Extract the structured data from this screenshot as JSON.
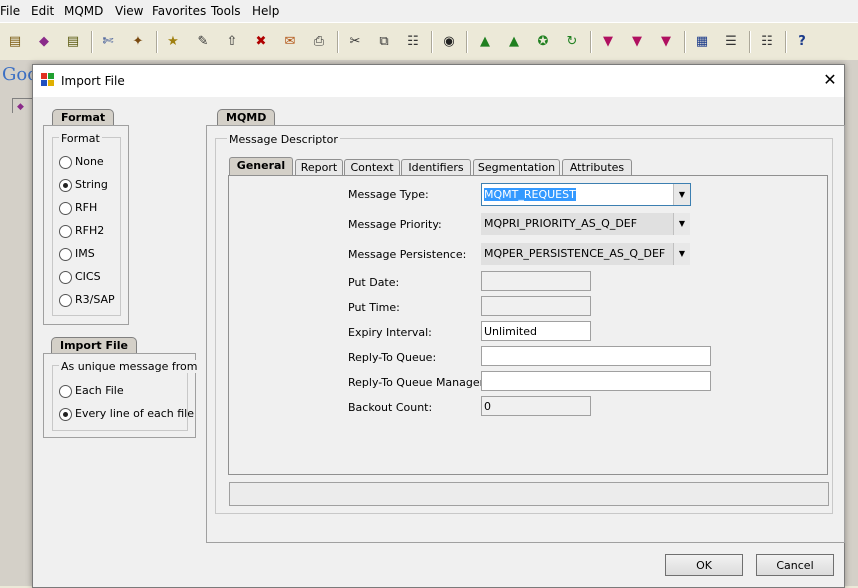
{
  "menubar": {
    "items": [
      "File",
      "Edit",
      "MQMD",
      "View",
      "Favorites",
      "Tools",
      "Help"
    ]
  },
  "background": {
    "logo_text": "Goo"
  },
  "dialog": {
    "title": "Import File",
    "format_tab": "Format",
    "format_group_label": "Format",
    "format_options": [
      "None",
      "String",
      "RFH",
      "RFH2",
      "IMS",
      "CICS",
      "R3/SAP"
    ],
    "format_selected": "String",
    "import_tab": "Import File",
    "import_group_label": "As unique message from",
    "import_options": [
      "Each File",
      "Every line of each file"
    ],
    "import_selected": "Every line of each file",
    "mqmd_tab": "MQMD",
    "md_group_label": "Message Descriptor",
    "tabs": [
      "General",
      "Report",
      "Context",
      "Identifiers",
      "Segmentation",
      "Attributes"
    ],
    "active_tab": "General",
    "fields": {
      "message_type_label": "Message Type:",
      "message_type_value": "MQMT_REQUEST",
      "message_priority_label": "Message Priority:",
      "message_priority_value": "MQPRI_PRIORITY_AS_Q_DEF",
      "message_persistence_label": "Message Persistence:",
      "message_persistence_value": "MQPER_PERSISTENCE_AS_Q_DEF",
      "put_date_label": "Put Date:",
      "put_date_value": "",
      "put_time_label": "Put Time:",
      "put_time_value": "",
      "expiry_label": "Expiry Interval:",
      "expiry_value": "Unlimited",
      "reply_q_label": "Reply-To Queue:",
      "reply_q_value": "",
      "reply_qmgr_label": "Reply-To Queue Manager:",
      "reply_qmgr_value": "",
      "backout_label": "Backout Count:",
      "backout_value": "0"
    },
    "ok_label": "OK",
    "cancel_label": "Cancel"
  },
  "toolbar_icons": [
    "open-icon",
    "mqmd-icon",
    "save-icon",
    "cut-icon",
    "wand-icon",
    "new-icon",
    "edit-icon",
    "load-icon",
    "delete-icon",
    "export-icon",
    "print-icon",
    "scissors-icon",
    "copy-icon",
    "paste-icon",
    "find-icon",
    "queue-add-icon",
    "queue-add2-icon",
    "queue-star-icon",
    "queue-refresh-icon",
    "queue-down-icon",
    "queue-down2-icon",
    "queue-down3-icon",
    "table-icon",
    "list-icon",
    "grid-icon",
    "help-icon"
  ]
}
